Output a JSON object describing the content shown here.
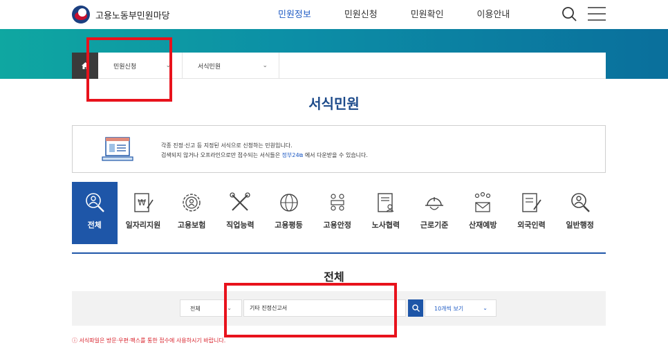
{
  "header": {
    "logo_text": "고용노동부민원마당",
    "nav": [
      "민원정보",
      "민원신청",
      "민원확인",
      "이용안내"
    ],
    "active_nav": "민원정보"
  },
  "breadcrumb": {
    "level1": "민원신청",
    "level2": "서식민원"
  },
  "page": {
    "title": "서식민원",
    "info_line1": "각종 진정·신고 등 지정된 서식으로 신청하는 민원입니다.",
    "info_line2_prefix": "검색되지 않거나 오프라인으로만 접수되는 서식들은",
    "info_link": "정부24",
    "info_line2_suffix": "에서 다운받을 수 있습니다."
  },
  "categories": [
    {
      "label": "전체",
      "icon": "magnifier-person-icon",
      "active": true
    },
    {
      "label": "일자리지원",
      "icon": "won-document-icon",
      "active": false
    },
    {
      "label": "고용보험",
      "icon": "gear-person-icon",
      "active": false
    },
    {
      "label": "직업능력",
      "icon": "tools-icon",
      "active": false
    },
    {
      "label": "고용평등",
      "icon": "globe-cycle-icon",
      "active": false
    },
    {
      "label": "고용안정",
      "icon": "team-meeting-icon",
      "active": false
    },
    {
      "label": "노사협력",
      "icon": "document-person-icon",
      "active": false
    },
    {
      "label": "근로기준",
      "icon": "hardhat-icon",
      "active": false
    },
    {
      "label": "산재예방",
      "icon": "people-mail-icon",
      "active": false
    },
    {
      "label": "외국인력",
      "icon": "document-pen-icon",
      "active": false
    },
    {
      "label": "일반행정",
      "icon": "magnifier-person-icon",
      "active": false
    }
  ],
  "list": {
    "section_title": "전체",
    "filter_value": "전체",
    "keyword": "기타 진정신고서",
    "page_size": "10개씩 보기",
    "notice": "ⓘ 서식파일은 방문·우편·팩스를 통한 접수에 사용하시기 바랍니다."
  },
  "colors": {
    "primary": "#1e56a8",
    "link": "#1f5bc4",
    "banner_start": "#0fa7a1",
    "banner_end": "#0a6f9c",
    "notice": "#d8202a",
    "highlight": "#e8121c"
  }
}
